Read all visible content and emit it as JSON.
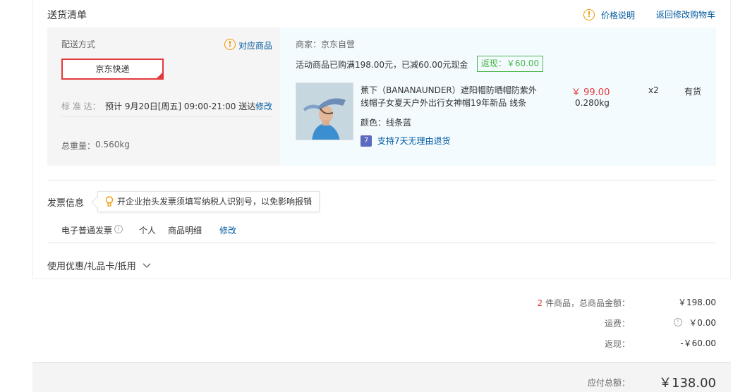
{
  "header": {
    "title": "送货清单",
    "price_explain": "价格说明",
    "back_to_cart": "返回修改购物车"
  },
  "shipping": {
    "method_label": "配送方式",
    "related_goods": "对应商品",
    "selected_method": "京东快递",
    "standard_label": "标 准 达：",
    "standard_value": "预计 9月20日[周五] 09:00-21:00 送达",
    "modify": "修改",
    "weight_label": "总重量：",
    "weight_value": "0.560kg"
  },
  "store": {
    "seller_label": "商家：京东自营",
    "promo_text": "活动商品已购满198.00元，已减60.00元现金",
    "rebate_badge": "返现：￥60.00"
  },
  "product": {
    "name_line1": "蕉下（BANANAUNDER）遮阳帽防晒帽防紫外",
    "name_line2": "线帽子女夏天户外出行女神帽19年新品 线条",
    "color": "颜色：线条蓝",
    "return_icon_text": "7",
    "return_policy": "支持7天无理由退货",
    "price": "￥ 99.00",
    "weight": "0.280kg",
    "quantity": "x2",
    "stock": "有货"
  },
  "invoice": {
    "title": "发票信息",
    "tip": "开企业抬头发票须填写纳税人识别号，以免影响报销",
    "type": "电子普通发票",
    "holder": "个人",
    "content": "商品明细",
    "modify": "修改"
  },
  "coupon": {
    "title": "使用优惠/礼品卡/抵用"
  },
  "summary": {
    "count": "2",
    "goods_total_label": " 件商品，总商品金额：",
    "goods_total_value": "￥198.00",
    "freight_label": "运费：",
    "freight_value": "￥0.00",
    "rebate_label": "返现：",
    "rebate_value": "-￥60.00",
    "payable_label": "应付总额：",
    "payable_value": "￥138.00"
  },
  "colors": {
    "accent_red": "#e4393c",
    "link_blue": "#005aa0",
    "green": "#4bb54b",
    "warning_orange": "#f39800"
  }
}
